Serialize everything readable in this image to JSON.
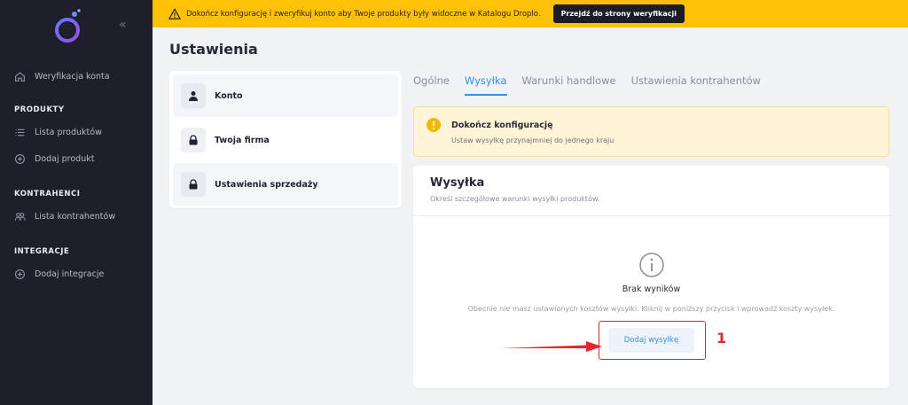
{
  "sidebar": {
    "collapse_icon": "«",
    "items_top": [
      {
        "label": "Weryfikacja konta",
        "icon": "home-icon"
      }
    ],
    "sections": [
      {
        "title": "PRODUKTY",
        "items": [
          {
            "label": "Lista produktów",
            "icon": "list-icon"
          },
          {
            "label": "Dodaj produkt",
            "icon": "plus-circle-icon"
          }
        ]
      },
      {
        "title": "KONTRAHENCI",
        "items": [
          {
            "label": "Lista kontrahentów",
            "icon": "users-icon"
          }
        ]
      },
      {
        "title": "INTEGRACJE",
        "items": [
          {
            "label": "Dodaj integracje",
            "icon": "plus-circle-icon"
          }
        ]
      }
    ]
  },
  "banner": {
    "text": "Dokończ konfigurację i zweryfikuj konto aby Twoje produkty były widoczne w Katalogu Droplo.",
    "button_label": "Przejdź do strony weryfikacji",
    "color": "#ffc107"
  },
  "page": {
    "title": "Ustawienia"
  },
  "settings_menu": [
    {
      "label": "Konto",
      "icon": "user-icon",
      "active": true
    },
    {
      "label": "Twoja firma",
      "icon": "lock-icon",
      "active": false
    },
    {
      "label": "Ustawienia sprzedaży",
      "icon": "lock-icon",
      "active": true
    }
  ],
  "tabs": [
    {
      "label": "Ogólne",
      "active": false
    },
    {
      "label": "Wysyłka",
      "active": true
    },
    {
      "label": "Warunki handlowe",
      "active": false
    },
    {
      "label": "Ustawienia kontrahentów",
      "active": false
    }
  ],
  "alert": {
    "title": "Dokończ konfigurację",
    "text": "Ustaw wysyłkę przynajmniej do jednego kraju"
  },
  "shipping_card": {
    "title": "Wysyłka",
    "subtitle": "Określ szczegółowe warunki wysyłki produktów.",
    "empty_title": "Brak wyników",
    "empty_text": "Obecnie nie masz ustawionych kosztów wysyłki. Kliknij w poniższy przycisk i wprowadź koszty wysyłek.",
    "add_button_label": "Dodaj wysyłkę"
  },
  "annotation": {
    "number": "1",
    "color": "#e5262f"
  },
  "colors": {
    "accent": "#3a8ee6",
    "sidebar_bg": "#1f1f2b",
    "logo": "#7b5cf0"
  }
}
